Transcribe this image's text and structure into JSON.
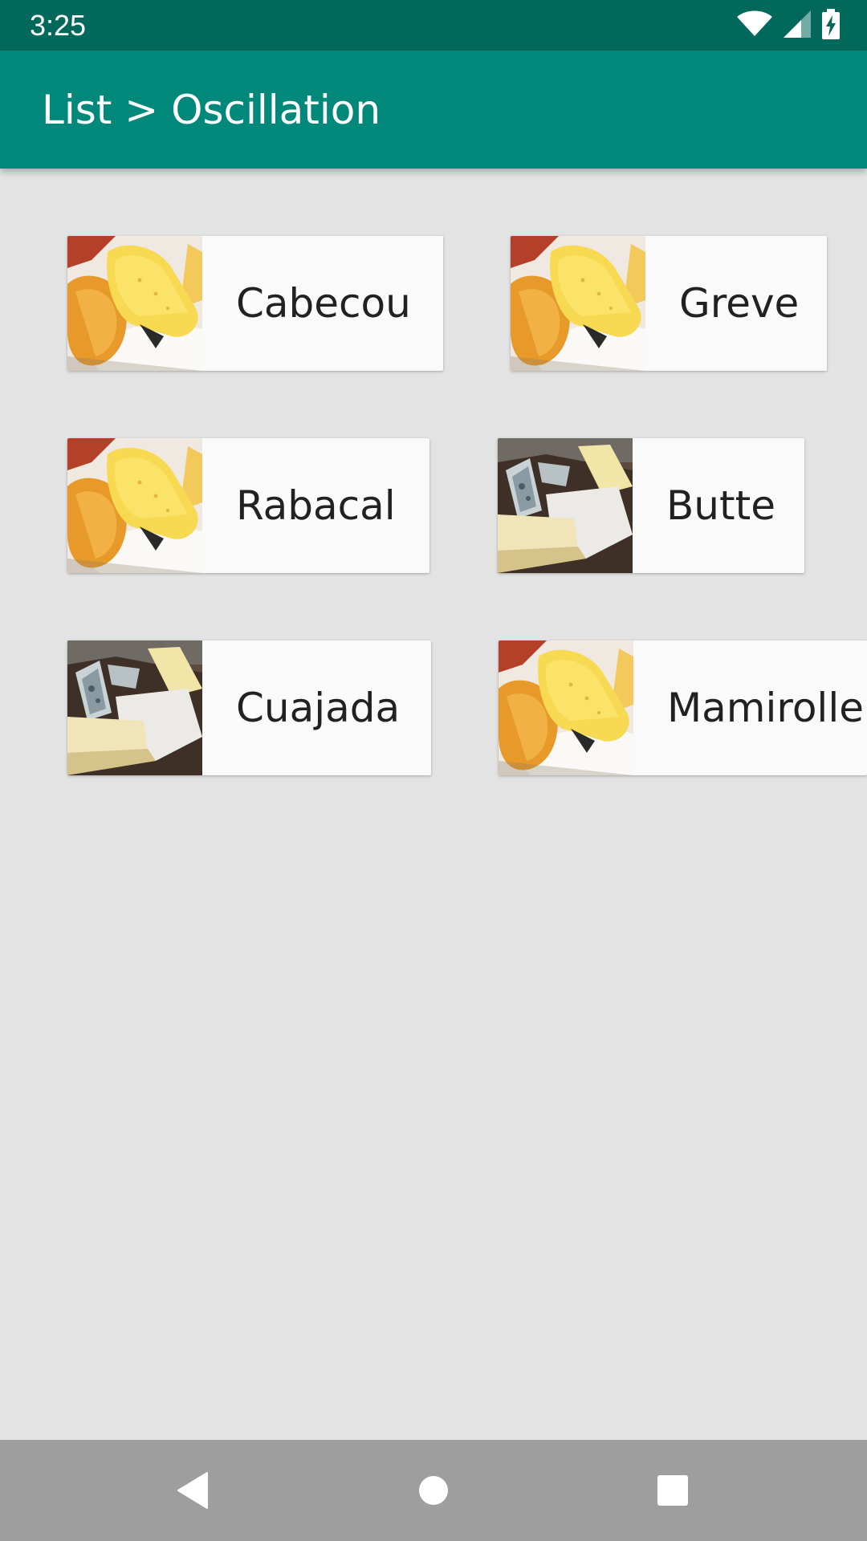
{
  "status_bar": {
    "time": "3:25",
    "icons": [
      "wifi-icon",
      "signal-icon",
      "battery-charging-icon"
    ]
  },
  "app_bar": {
    "title": "List > Oscillation",
    "color": "#00897b"
  },
  "cards": [
    {
      "label": "Cabecou",
      "image": "yellow-cheese-image"
    },
    {
      "label": "Greve",
      "image": "yellow-cheese-image"
    },
    {
      "label": "Rabacal",
      "image": "yellow-cheese-image"
    },
    {
      "label": "Butte",
      "image": "blue-cheese-plate-image"
    },
    {
      "label": "Cuajada",
      "image": "blue-cheese-plate-image"
    },
    {
      "label": "Mamirolle",
      "image": "yellow-cheese-image"
    }
  ],
  "nav_bar": {
    "buttons": [
      "back-icon",
      "home-icon",
      "recents-icon"
    ]
  }
}
